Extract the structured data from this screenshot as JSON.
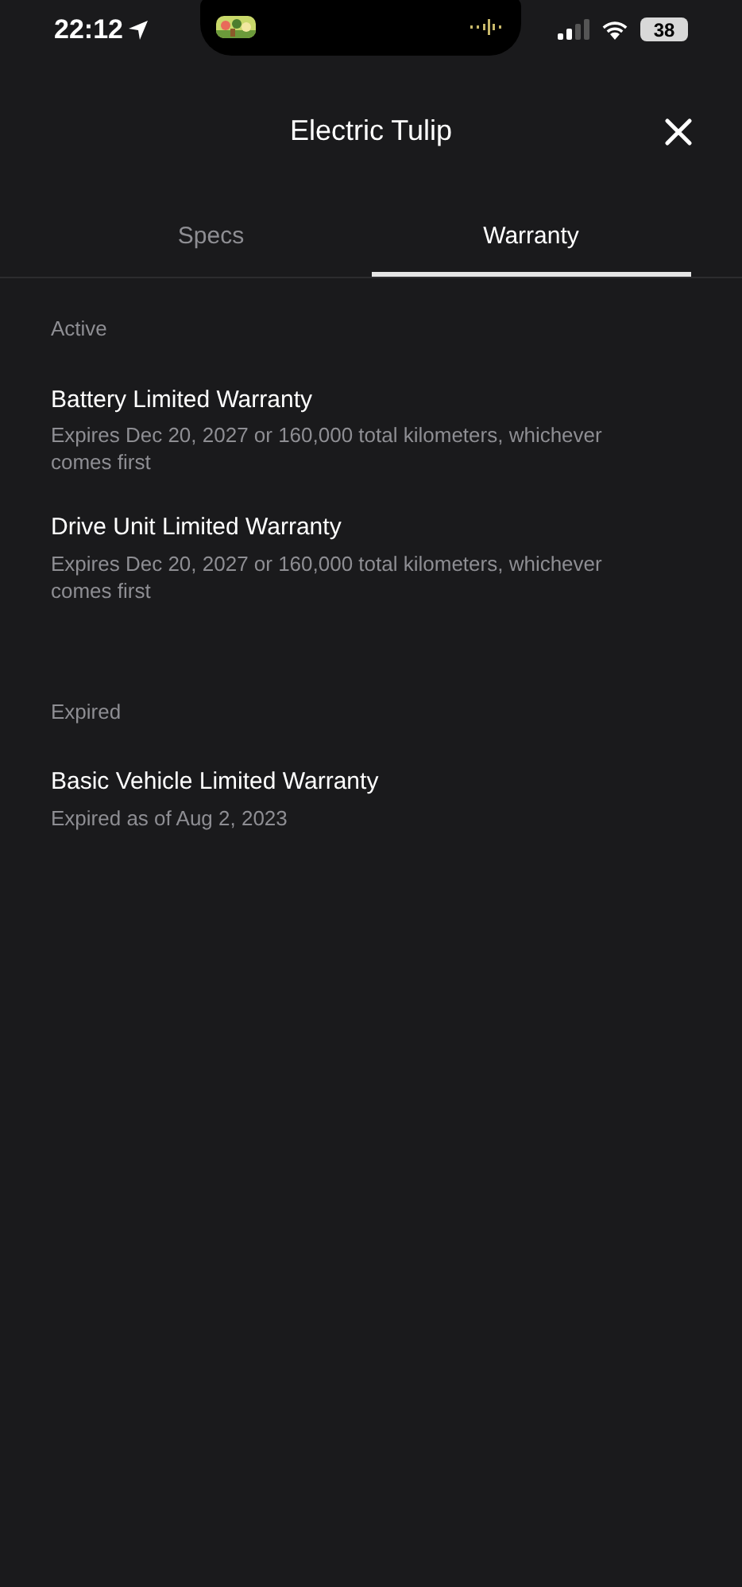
{
  "status_bar": {
    "time": "22:12",
    "battery": "38"
  },
  "header": {
    "title": "Electric Tulip"
  },
  "tabs": [
    {
      "label": "Specs",
      "selected": false
    },
    {
      "label": "Warranty",
      "selected": true
    }
  ],
  "sections": [
    {
      "heading": "Active",
      "items": [
        {
          "title": "Battery Limited Warranty",
          "detail": "Expires Dec 20, 2027 or 160,000 total kilometers, whichever comes first"
        },
        {
          "title": "Drive Unit Limited Warranty",
          "detail": "Expires Dec 20, 2027 or 160,000 total kilometers, whichever comes first"
        }
      ]
    },
    {
      "heading": "Expired",
      "items": [
        {
          "title": "Basic Vehicle Limited Warranty",
          "detail": "Expired as of Aug 2, 2023"
        }
      ]
    }
  ]
}
